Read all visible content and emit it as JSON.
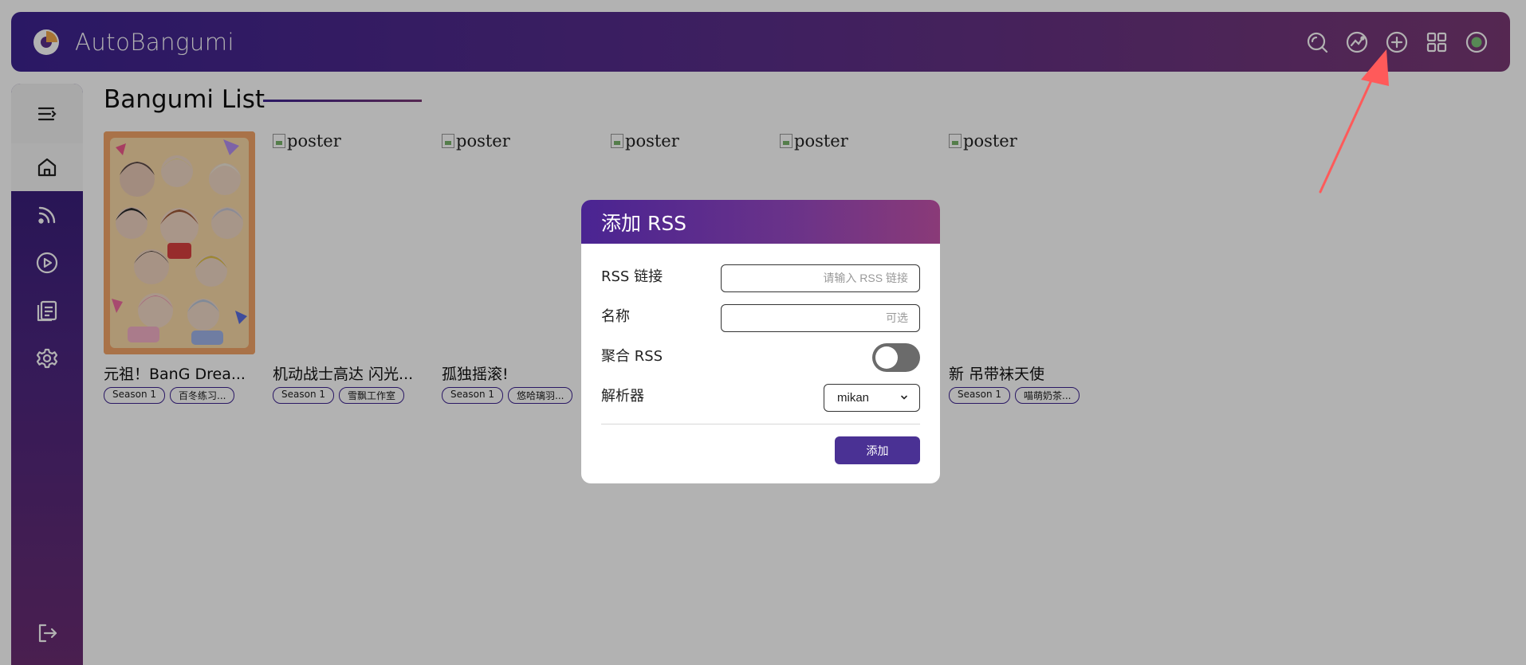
{
  "app": {
    "title": "AutoBangumi"
  },
  "topbar": {
    "icons": [
      "search-icon",
      "bangumi-icon",
      "add-icon",
      "grid-icon",
      "status-icon"
    ],
    "status_color": "#7dc47a"
  },
  "sidebar": {
    "items": [
      {
        "name": "home",
        "icon": "home-icon"
      },
      {
        "name": "rss",
        "icon": "rss-icon"
      },
      {
        "name": "player",
        "icon": "play-icon"
      },
      {
        "name": "log",
        "icon": "log-icon"
      },
      {
        "name": "config",
        "icon": "gear-icon"
      }
    ],
    "logout_icon": "logout-icon"
  },
  "main": {
    "title": "Bangumi List",
    "cards": [
      {
        "title": "元祖！BanG Drea...",
        "poster_alt": "poster",
        "season": "Season 1",
        "group": "百冬练习..."
      },
      {
        "title": "机动战士高达 闪光...",
        "poster_alt": "poster",
        "season": "Season 1",
        "group": "雪飘工作室"
      },
      {
        "title": "孤独摇滚!",
        "poster_alt": "poster",
        "season": "Season 1",
        "group": "悠哈璃羽..."
      },
      {
        "title": "",
        "poster_alt": "poster",
        "season": "",
        "group": ""
      },
      {
        "title": "",
        "poster_alt": "poster",
        "season": "",
        "group": ""
      },
      {
        "title": "新 吊带袜天使",
        "poster_alt": "poster",
        "season": "Season 1",
        "group": "喵萌奶茶..."
      }
    ]
  },
  "dialog": {
    "title": "添加 RSS",
    "rss_label": "RSS 链接",
    "rss_placeholder": "请输入 RSS 链接",
    "name_label": "名称",
    "name_placeholder": "可选",
    "aggregate_label": "聚合 RSS",
    "aggregate_on": false,
    "parser_label": "解析器",
    "parser_value": "mikan",
    "submit_label": "添加"
  },
  "colors": {
    "brand_start": "#3d2390",
    "brand_end": "#7a3975",
    "button": "#4a3194",
    "annotation": "#ff5a5a"
  }
}
